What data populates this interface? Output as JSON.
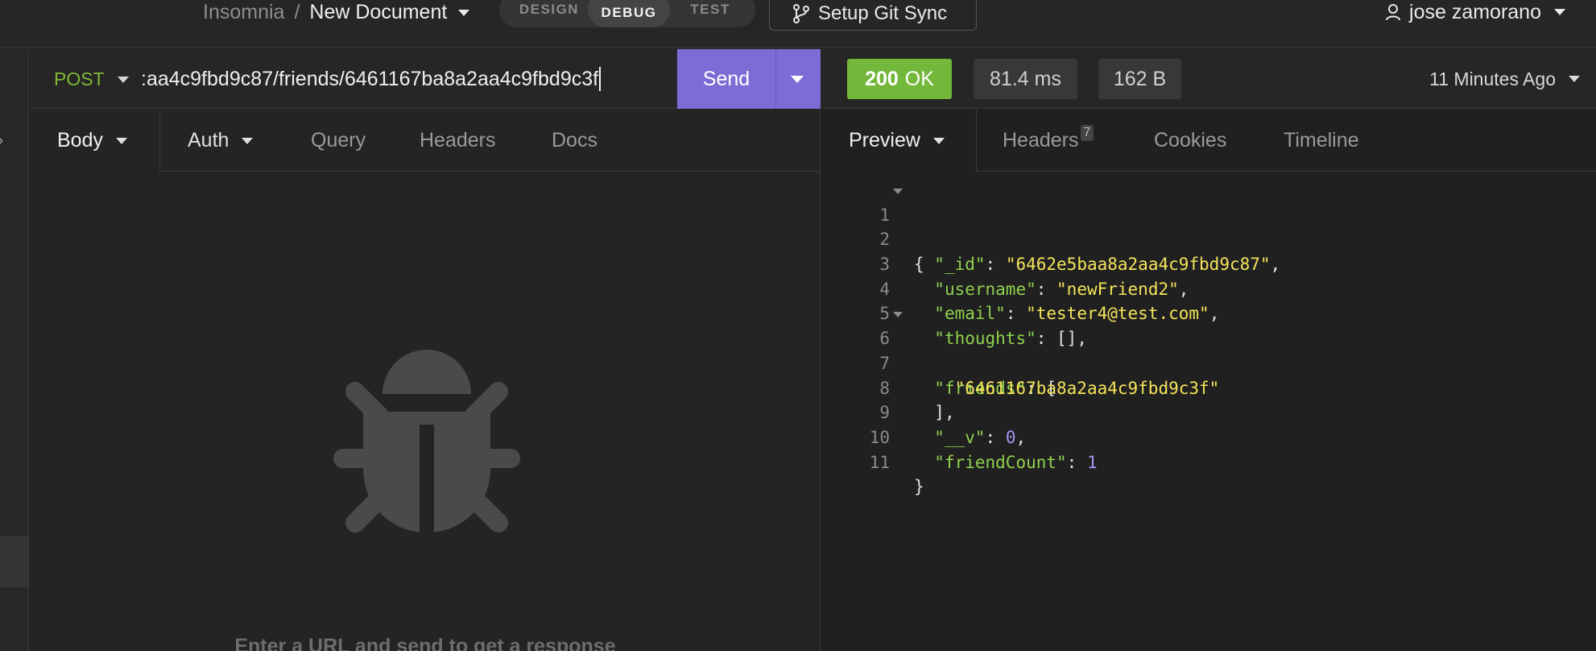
{
  "topbar": {
    "app_name": "Insomnia",
    "separator": "/",
    "document_name": "New Document",
    "modes": [
      "DESIGN",
      "DEBUG",
      "TEST"
    ],
    "active_mode": "DEBUG",
    "git_sync_label": "Setup Git Sync",
    "user_name": "jose zamorano"
  },
  "request": {
    "method": "POST",
    "url_visible": ":aa4c9fbd9c87/friends/6461167ba8a2aa4c9fbd9c3f",
    "send_label": "Send",
    "tabs": {
      "body": "Body",
      "auth": "Auth",
      "query": "Query",
      "headers": "Headers",
      "docs": "Docs"
    },
    "empty_message": "Enter a URL and send to get a response"
  },
  "response": {
    "status_code": "200",
    "status_text": "OK",
    "time": "81.4 ms",
    "size": "162 B",
    "history": "11 Minutes Ago",
    "tabs": {
      "preview": "Preview",
      "headers": "Headers",
      "headers_count": "7",
      "cookies": "Cookies",
      "timeline": "Timeline"
    },
    "lines": [
      "1",
      "2",
      "3",
      "4",
      "5",
      "6",
      "7",
      "8",
      "9",
      "10",
      "11"
    ],
    "json": {
      "brace_open": "{",
      "id_key": "\"_id\"",
      "id_val": "\"6462e5baa8a2aa4c9fbd9c87\"",
      "username_key": "\"username\"",
      "username_val": "\"newFriend2\"",
      "email_key": "\"email\"",
      "email_val": "\"tester4@test.com\"",
      "thoughts_key": "\"thoughts\"",
      "thoughts_val": "[]",
      "friends_key": "\"friends\"",
      "friends_open": "[",
      "friend_0": "\"6461167ba8a2aa4c9fbd9c3f\"",
      "friends_close": "],",
      "v_key": "\"__v\"",
      "v_val": "0",
      "friendcount_key": "\"friendCount\"",
      "friendcount_val": "1",
      "brace_close": "}"
    }
  },
  "colors": {
    "send_button": "#7f6bd6",
    "status_ok": "#73b73b",
    "method_post": "#7fb935",
    "json_key": "#8fd14f",
    "json_string": "#f5e45a",
    "json_number": "#a892f0"
  },
  "icons": {
    "git": "git-branch-icon",
    "user": "user-icon",
    "empty_state": "bug-icon"
  }
}
